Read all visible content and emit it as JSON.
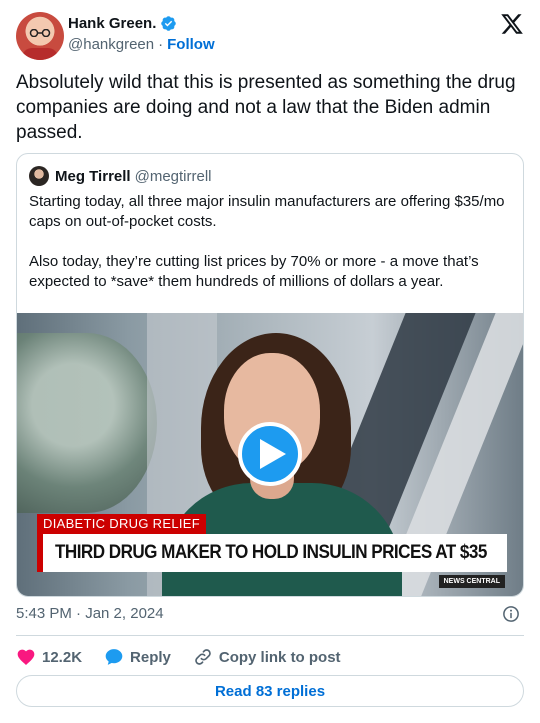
{
  "author": {
    "name": "Hank Green.",
    "handle": "@hankgreen",
    "separator": "·",
    "follow_label": "Follow"
  },
  "tweet": {
    "text": "Absolutely wild that this is presented as something the drug companies are doing and not a law that the Biden admin passed."
  },
  "quote": {
    "name": "Meg Tirrell",
    "handle": "@megtirrell",
    "text": "Starting today, all three major insulin manufacturers are offering $35/mo caps on out-of-pocket costs.\n\nAlso today, they’re cutting list prices by 70% or more - a move that’s expected to *save* them hundreds of millions of dollars a year.",
    "media": {
      "tag": "DIABETIC DRUG RELIEF",
      "headline": "THIRD DRUG MAKER TO HOLD INSULIN PRICES AT $35",
      "network_badge": "NEWS CENTRAL"
    }
  },
  "meta": {
    "timestamp": "5:43 PM · Jan 2, 2024"
  },
  "actions": {
    "like_count": "12.2K",
    "reply_label": "Reply",
    "copy_label": "Copy link to post",
    "read_replies_label": "Read 83 replies"
  },
  "colors": {
    "accent": "#1d9bf0",
    "link": "#006fd6",
    "like": "#f91880",
    "muted": "#536471",
    "border": "#cfd9de",
    "news_red": "#cc0000"
  },
  "icons": {
    "verified": "verified-badge-icon",
    "brand": "x-logo-icon",
    "play": "play-icon",
    "info": "info-icon",
    "like": "heart-icon",
    "reply": "speech-bubble-icon",
    "copy": "link-icon"
  }
}
